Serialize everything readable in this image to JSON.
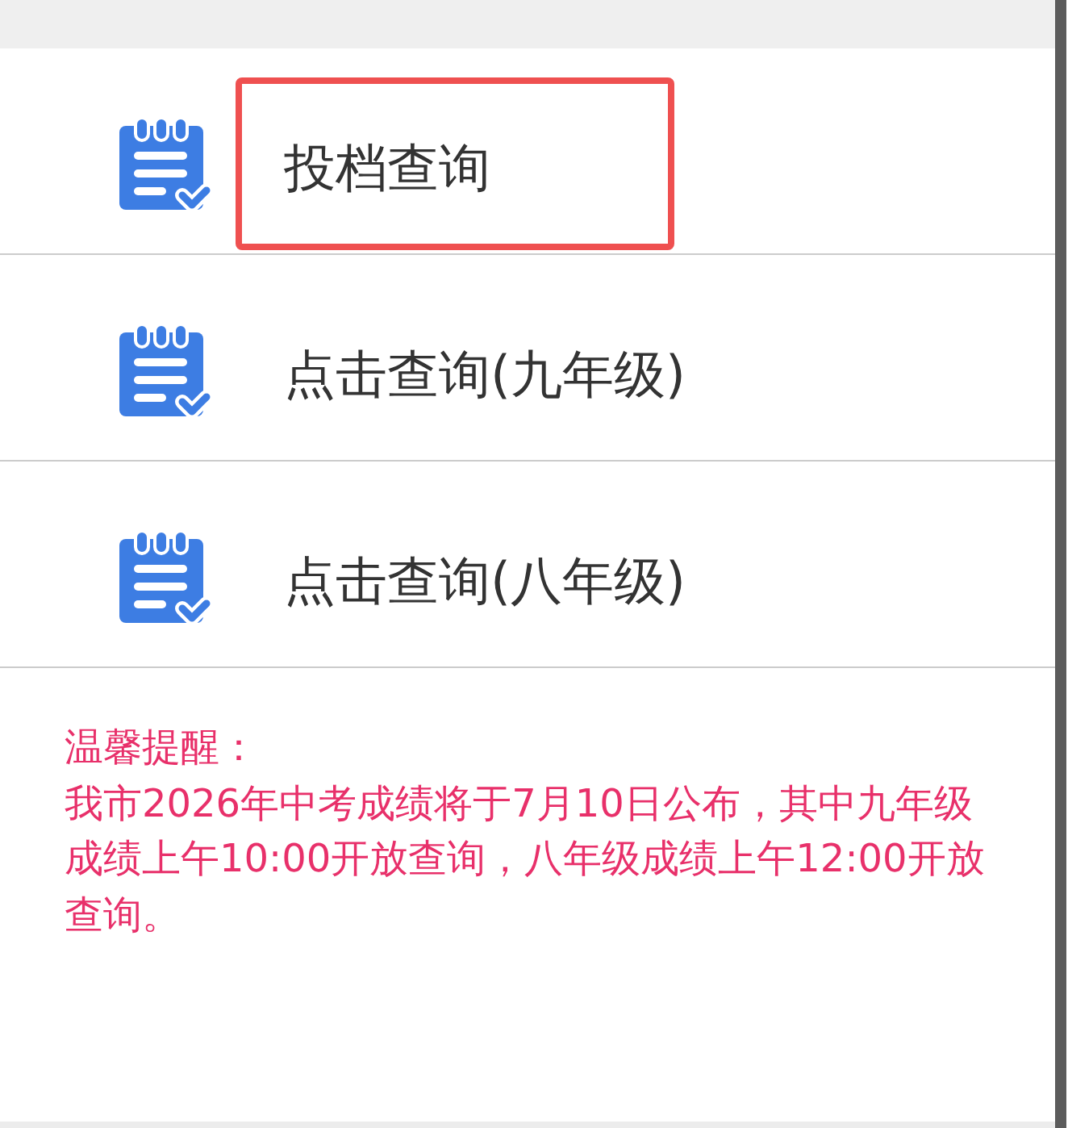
{
  "items": [
    {
      "label": "投档查询",
      "highlighted": true
    },
    {
      "label": "点击查询(九年级)",
      "highlighted": false
    },
    {
      "label": "点击查询(八年级)",
      "highlighted": false
    }
  ],
  "notice": {
    "heading": "温馨提醒：",
    "text": "我市2026年中考成绩将于7月10日公布，其中九年级成绩上午10:00开放查询，八年级成绩上午12:00开放查询。"
  }
}
